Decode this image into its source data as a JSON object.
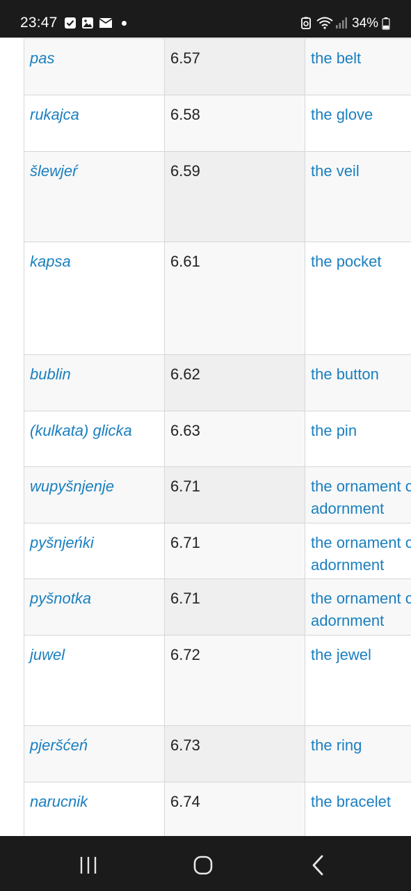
{
  "status_bar": {
    "time": "23:47",
    "battery": "34%",
    "icons": [
      "checkbox-notification-icon",
      "gallery-notification-icon",
      "mail-notification-icon",
      "recycle-icon",
      "wifi-icon",
      "signal-icon",
      "battery-icon"
    ]
  },
  "table": {
    "rows": [
      {
        "word": "pas",
        "num": "6.57",
        "meaning": [
          "the belt"
        ]
      },
      {
        "word": "rukajca",
        "num": "6.58",
        "meaning": [
          "the glove"
        ]
      },
      {
        "word": "šlewjeŕ",
        "num": "6.59",
        "meaning": [
          "the veil"
        ]
      },
      {
        "word": "kapsa",
        "num": "6.61",
        "meaning": [
          "the pocket"
        ]
      },
      {
        "word": "bublin",
        "num": "6.62",
        "meaning": [
          "the button"
        ]
      },
      {
        "word": "(kulkata) glicka",
        "num": "6.63",
        "meaning": [
          "the pin"
        ]
      },
      {
        "word": "wupyšnjenje",
        "num": "6.71",
        "meaning": [
          "the ornament or",
          "adornment"
        ]
      },
      {
        "word": "pyšnjeńki",
        "num": "6.71",
        "meaning": [
          "the ornament or",
          "adornment"
        ]
      },
      {
        "word": "pyšnotka",
        "num": "6.71",
        "meaning": [
          "the ornament or",
          "adornment"
        ]
      },
      {
        "word": "juwel",
        "num": "6.72",
        "meaning": [
          "the jewel"
        ]
      },
      {
        "word": "pjeršćeń",
        "num": "6.73",
        "meaning": [
          "the ring"
        ]
      },
      {
        "word": "narucnik",
        "num": "6.74",
        "meaning": [
          "the bracelet"
        ]
      }
    ]
  },
  "nav_bar": {
    "buttons": [
      "recent-apps",
      "home",
      "back"
    ]
  }
}
